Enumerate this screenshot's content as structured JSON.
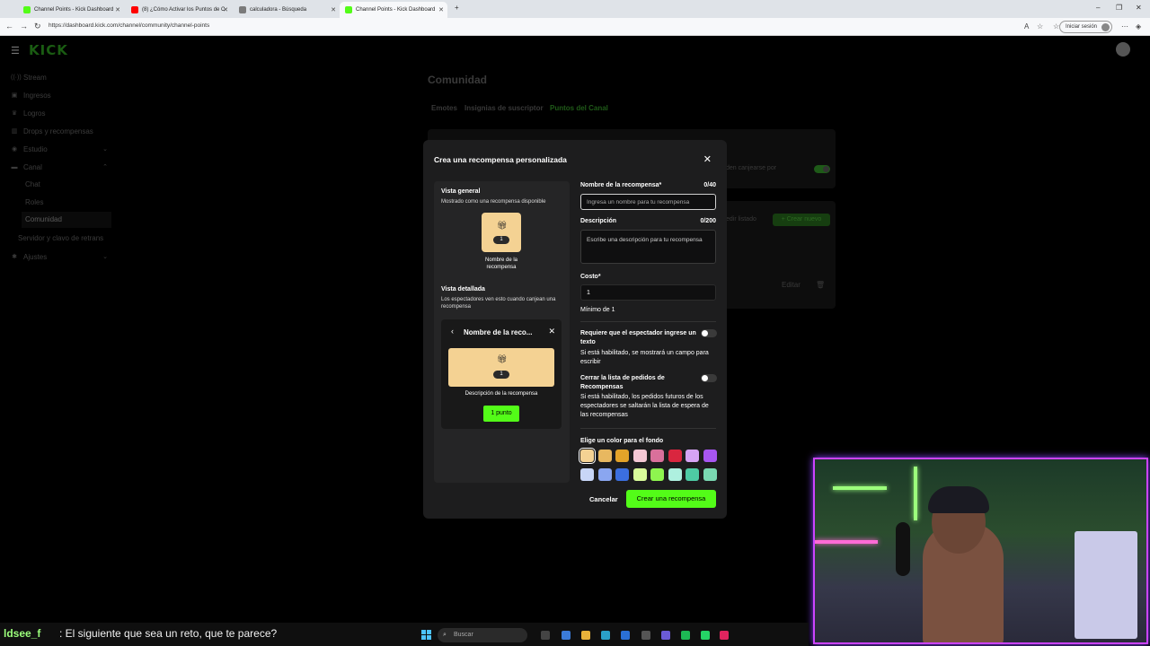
{
  "browser": {
    "tabs": [
      {
        "title": "Channel Points - Kick Dashboard",
        "color": "#53fc18"
      },
      {
        "title": "(8) ¿Cómo Activar los Puntos de C",
        "color": "#ff0000"
      },
      {
        "title": "calculadora - Búsqueda",
        "color": "#7a7a7a"
      },
      {
        "title": "Channel Points - Kick Dashboard",
        "color": "#53fc18"
      }
    ],
    "url": "https://dashboard.kick.com/channel/community/channel-points",
    "signin_label": "Iniciar sesión"
  },
  "sidebar": {
    "logo": "KICK",
    "items": [
      {
        "label": "Stream",
        "icon": "broadcast-icon",
        "glyph": "((·))"
      },
      {
        "label": "Ingresos",
        "icon": "wallet-icon",
        "glyph": "▣"
      },
      {
        "label": "Logros",
        "icon": "trophy-icon",
        "glyph": "♛"
      },
      {
        "label": "Drops y recompensas",
        "icon": "gift-icon",
        "glyph": "▥"
      },
      {
        "label": "Estudio",
        "icon": "palette-icon",
        "glyph": "◉"
      },
      {
        "label": "Canal",
        "icon": "channel-icon",
        "glyph": "▬"
      }
    ],
    "subitems": [
      "Chat",
      "Roles",
      "Comunidad"
    ],
    "extra": "Servidor y clavo de retrans",
    "settings": {
      "label": "Ajustes",
      "icon": "gear-icon",
      "glyph": "✱"
    }
  },
  "page": {
    "title": "Comunidad",
    "tabs": [
      "Emotes",
      "Insignias de suscriptor",
      "Puntos del Canal"
    ],
    "bg_text_1": "den canjearse por",
    "bg_text_2": "edir listado",
    "bg_create": "+ Crear nuevo",
    "bg_edit": "Editar"
  },
  "modal": {
    "title": "Crea una recompensa personalizada",
    "preview": {
      "overview_title": "Vista general",
      "overview_sub": "Mostrado como una recompensa disponible",
      "tile_count": "1",
      "tile_name": "Nombre de la recompensa",
      "detail_title": "Vista detallada",
      "detail_sub": "Los espectadores ven esto cuando canjean una recompensa",
      "detail_header": "Nombre de la reco...",
      "detail_count": "1",
      "detail_desc": "Descripción de la recompensa",
      "detail_button": "1 punto"
    },
    "form": {
      "name_label": "Nombre de la recompensa*",
      "name_count": "0/40",
      "name_placeholder": "Ingresa un nombre para tu recompensa",
      "desc_label": "Descripción",
      "desc_count": "0/200",
      "desc_placeholder": "Escribe una descripción para tu recompensa",
      "cost_label": "Costo*",
      "cost_value": "1",
      "cost_hint": "Mínimo de 1",
      "toggle1_label": "Requiere que el espectador ingrese un texto",
      "toggle1_desc": "Si está habilitado, se mostrará un campo para escribir",
      "toggle2_label": "Cerrar la lista de pedidos de Recompensas",
      "toggle2_desc": "Si está habilitado, los pedidos futuros de los espectadores se saltarán la lista de espera de las recompensas",
      "color_label": "Elige un color para el fondo",
      "colors": [
        "#f4d293",
        "#e8b860",
        "#e3a329",
        "#f3c7d4",
        "#d9709b",
        "#d9263f",
        "#d6a3f5",
        "#a856f2",
        "#c8d6f7",
        "#8aa6f0",
        "#3b6fe0",
        "#d9fc9a",
        "#8ef54f",
        "#aef0df",
        "#4ecba4",
        "#7ad8b2"
      ],
      "cancel": "Cancelar",
      "create": "Crear una recompensa"
    }
  },
  "chat": {
    "user": "ldsee_f",
    "message": ": El siguiente que sea un reto, que te parece?"
  },
  "taskbar": {
    "search": "Buscar"
  }
}
